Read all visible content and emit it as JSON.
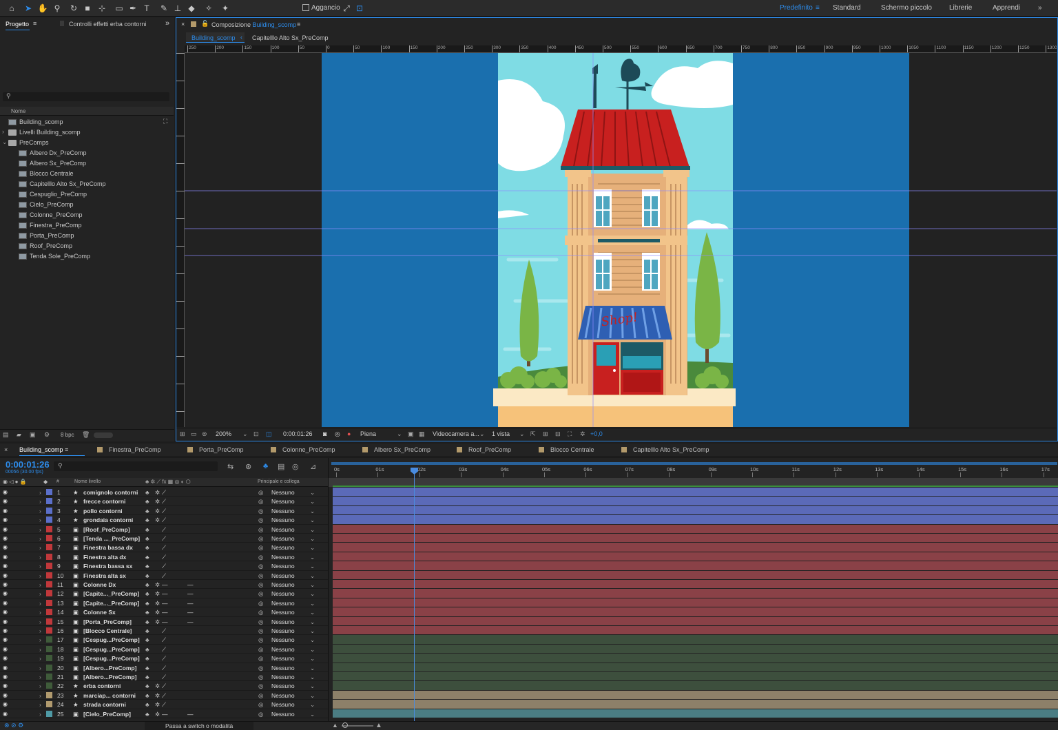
{
  "toolbar": {
    "snapping_label": "Aggancio",
    "workspaces": [
      "Predefinito",
      "Standard",
      "Schermo piccolo",
      "Librerie",
      "Apprendi"
    ],
    "active_workspace": "Predefinito"
  },
  "project_panel": {
    "tab_project": "Progetto",
    "tab_effects": "Controlli effetti erba contorni",
    "search_placeholder": "",
    "column_name": "Nome",
    "items": [
      {
        "label": "Building_scomp",
        "type": "comp",
        "indent": 0
      },
      {
        "label": "Livelli Building_scomp",
        "type": "folder",
        "indent": 0,
        "expanded": false
      },
      {
        "label": "PreComps",
        "type": "folder",
        "indent": 0,
        "expanded": true
      },
      {
        "label": "Albero Dx_PreComp",
        "type": "comp",
        "indent": 1
      },
      {
        "label": "Albero Sx_PreComp",
        "type": "comp",
        "indent": 1
      },
      {
        "label": "Blocco Centrale",
        "type": "comp",
        "indent": 1
      },
      {
        "label": "Capitelllo Alto Sx_PreComp",
        "type": "comp",
        "indent": 1
      },
      {
        "label": "Cespuglio_PreComp",
        "type": "comp",
        "indent": 1
      },
      {
        "label": "Cielo_PreComp",
        "type": "comp",
        "indent": 1
      },
      {
        "label": "Colonne_PreComp",
        "type": "comp",
        "indent": 1
      },
      {
        "label": "Finestra_PreComp",
        "type": "comp",
        "indent": 1
      },
      {
        "label": "Porta_PreComp",
        "type": "comp",
        "indent": 1
      },
      {
        "label": "Roof_PreComp",
        "type": "comp",
        "indent": 1
      },
      {
        "label": "Tenda Sole_PreComp",
        "type": "comp",
        "indent": 1
      }
    ],
    "bpc": "8 bpc"
  },
  "composition_panel": {
    "title_prefix": "Composizione",
    "title_comp": "Building_scomp",
    "breadcrumb_active": "Building_scomp",
    "breadcrumb_next": "Capitelllo Alto Sx_PreComp",
    "ruler_labels": [
      "250",
      "200",
      "150",
      "100",
      "50",
      "0",
      "50",
      "100",
      "150",
      "200",
      "250",
      "300",
      "350",
      "400",
      "450",
      "500",
      "550",
      "600",
      "650",
      "700",
      "750",
      "800",
      "850",
      "900",
      "950",
      "1000",
      "1050",
      "1100",
      "1150",
      "1200",
      "1250",
      "1300"
    ],
    "zoom": "200%",
    "timecode": "0:00:01:26",
    "resolution": "Piena",
    "camera": "Videocamera a...",
    "views": "1 vista",
    "exposure": "+0,0",
    "sign_text": "Shop!"
  },
  "timeline": {
    "tabs": [
      "Building_scomp",
      "Finestra_PreComp",
      "Porta_PreComp",
      "Colonne_PreComp",
      "Albero Sx_PreComp",
      "Roof_PreComp",
      "Blocco Centrale",
      "Capitelllo Alto Sx_PreComp"
    ],
    "current_time": "0:00:01:26",
    "fps_info": "00056 (30.00 fps)",
    "col_num": "#",
    "col_layer_name": "Nome livello",
    "col_parent": "Principale e collega",
    "ruler_labels": [
      "0s",
      "01s",
      "02s",
      "03s",
      "04s",
      "05s",
      "06s",
      "07s",
      "08s",
      "09s",
      "10s",
      "11s",
      "12s",
      "13s",
      "14s",
      "15s",
      "16s",
      "17s"
    ],
    "playhead_seconds": 1.87,
    "layers": [
      {
        "num": "1",
        "name": "comignolo contorni",
        "kind": "shape",
        "color": "#5b6fc9",
        "parent": "Nessuno"
      },
      {
        "num": "2",
        "name": "frecce contorni",
        "kind": "shape",
        "color": "#5b6fc9",
        "parent": "Nessuno"
      },
      {
        "num": "3",
        "name": "pollo contorni",
        "kind": "shape",
        "color": "#5b6fc9",
        "parent": "Nessuno"
      },
      {
        "num": "4",
        "name": "grondaia contorni",
        "kind": "shape",
        "color": "#5b6fc9",
        "parent": "Nessuno"
      },
      {
        "num": "5",
        "name": "[Roof_PreComp]",
        "kind": "comp",
        "color": "#c0383b",
        "parent": "Nessuno"
      },
      {
        "num": "6",
        "name": "[Tenda ..._PreComp]",
        "kind": "comp",
        "color": "#c0383b",
        "parent": "Nessuno"
      },
      {
        "num": "7",
        "name": "Finestra bassa dx",
        "kind": "comp",
        "color": "#c0383b",
        "parent": "Nessuno"
      },
      {
        "num": "8",
        "name": "Finestra alta dx",
        "kind": "comp",
        "color": "#c0383b",
        "parent": "Nessuno"
      },
      {
        "num": "9",
        "name": "Finestra bassa sx",
        "kind": "comp",
        "color": "#c0383b",
        "parent": "Nessuno"
      },
      {
        "num": "10",
        "name": "Finestra alta sx",
        "kind": "comp",
        "color": "#c0383b",
        "parent": "Nessuno"
      },
      {
        "num": "11",
        "name": "Colonne Dx",
        "kind": "comp",
        "color": "#c0383b",
        "parent": "Nessuno"
      },
      {
        "num": "12",
        "name": "[Capite..._PreComp]",
        "kind": "comp",
        "color": "#c0383b",
        "parent": "Nessuno"
      },
      {
        "num": "13",
        "name": "[Capite..._PreComp]",
        "kind": "comp",
        "color": "#c0383b",
        "parent": "Nessuno"
      },
      {
        "num": "14",
        "name": "Colonne Sx",
        "kind": "comp",
        "color": "#c0383b",
        "parent": "Nessuno"
      },
      {
        "num": "15",
        "name": "[Porta_PreComp]",
        "kind": "comp",
        "color": "#c0383b",
        "parent": "Nessuno"
      },
      {
        "num": "16",
        "name": "[Blocco Centrale]",
        "kind": "comp",
        "color": "#c0383b",
        "parent": "Nessuno"
      },
      {
        "num": "17",
        "name": "[Cespug...PreComp]",
        "kind": "comp",
        "color": "#3f5b3a",
        "parent": "Nessuno"
      },
      {
        "num": "18",
        "name": "[Cespug...PreComp]",
        "kind": "comp",
        "color": "#3f5b3a",
        "parent": "Nessuno"
      },
      {
        "num": "19",
        "name": "[Cespug...PreComp]",
        "kind": "comp",
        "color": "#3f5b3a",
        "parent": "Nessuno"
      },
      {
        "num": "20",
        "name": "[Albero...PreComp]",
        "kind": "comp",
        "color": "#3f5b3a",
        "parent": "Nessuno"
      },
      {
        "num": "21",
        "name": "[Albero...PreComp]",
        "kind": "comp",
        "color": "#3f5b3a",
        "parent": "Nessuno"
      },
      {
        "num": "22",
        "name": "erba contorni",
        "kind": "shape",
        "color": "#3f5b3a",
        "parent": "Nessuno"
      },
      {
        "num": "23",
        "name": "marciap... contorni",
        "kind": "shape",
        "color": "#b09a6e",
        "parent": "Nessuno"
      },
      {
        "num": "24",
        "name": "strada contorni",
        "kind": "shape",
        "color": "#b09a6e",
        "parent": "Nessuno"
      },
      {
        "num": "25",
        "name": "[Cielo_PreComp]",
        "kind": "comp",
        "color": "#4f9aa5",
        "parent": "Nessuno"
      }
    ],
    "bar_colors": {
      "blue": "#5b6ab8",
      "red": "#8a4147",
      "green": "#3d4f3d",
      "tan": "#8d8069",
      "teal": "#4b7d83"
    }
  },
  "statusbar": {
    "toggle_label": "Passa a switch o modalità"
  },
  "colors": {
    "accent": "#2d8ceb",
    "comp_bg": "#1a6fae",
    "sky": "#7fdce4"
  }
}
